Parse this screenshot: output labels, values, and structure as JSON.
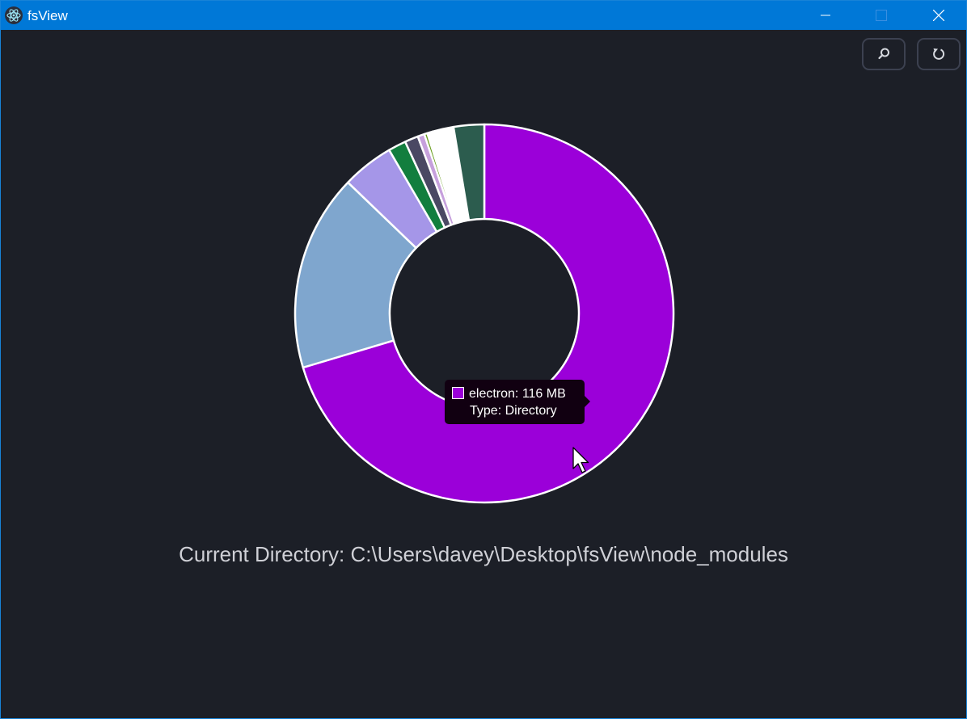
{
  "window": {
    "title": "fsView",
    "icon": "electron-icon",
    "controls": [
      "minimize-icon",
      "maximize-icon",
      "close-icon"
    ]
  },
  "toolbar": {
    "search_icon": "search-icon",
    "refresh_icon": "refresh-icon"
  },
  "chart_data": {
    "type": "pie",
    "donut": true,
    "slices": [
      {
        "name": "electron",
        "value": 116,
        "unit": "MB",
        "type": "Directory",
        "color": "#9b00d9"
      },
      {
        "name": "",
        "value": 27.7,
        "color": "#7fa6ce"
      },
      {
        "name": "",
        "value": 7.3,
        "color": "#a596e8"
      },
      {
        "name": "",
        "value": 2.5,
        "color": "#127e3e"
      },
      {
        "name": "",
        "value": 1.9,
        "color": "#4a4863"
      },
      {
        "name": "",
        "value": 0.95,
        "color": "#c6a0dc"
      },
      {
        "name": "",
        "value": 0.45,
        "color": "#6a9e20"
      },
      {
        "name": "",
        "value": 0.25,
        "color": "#3f3f66"
      },
      {
        "name": "",
        "value": 0.2,
        "color": "#2b5f76"
      },
      {
        "name": "",
        "value": 0.15,
        "color": "#ffffff"
      },
      {
        "name": "",
        "value": 0.12,
        "color": "#1f2c50"
      },
      {
        "name": "",
        "value": 3.0,
        "color": "#ffffff"
      },
      {
        "name": "",
        "value": 4.3,
        "color": "#2c5c4e"
      }
    ],
    "border_color": "#ffffff"
  },
  "tooltip": {
    "label": "electron: 116 MB",
    "type_line": "Type: Directory",
    "swatch_color": "#9b00d9"
  },
  "status": {
    "current_directory": "Current Directory: C:\\Users\\davey\\Desktop\\fsView\\node_modules"
  }
}
